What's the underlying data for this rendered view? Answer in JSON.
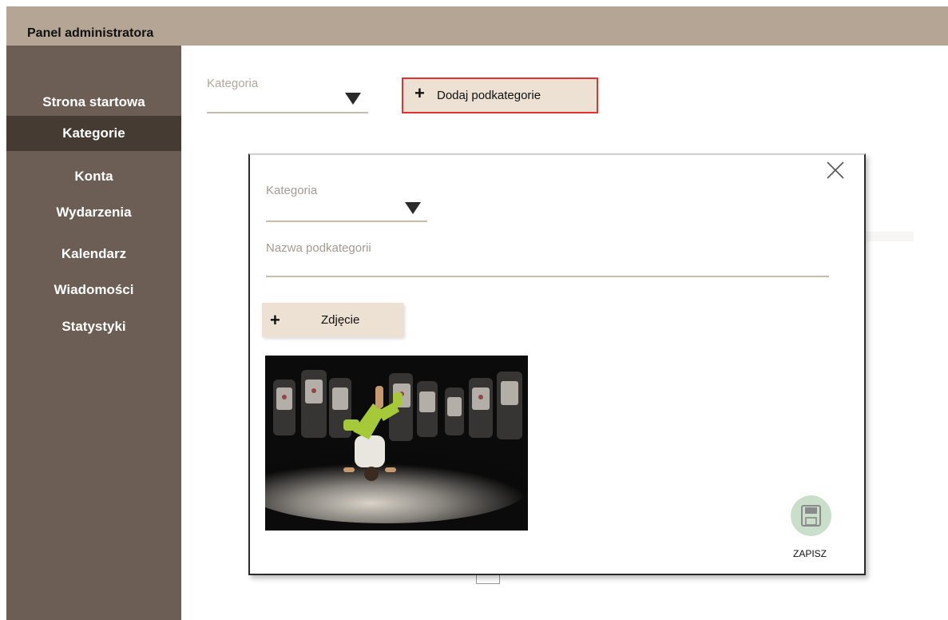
{
  "header": {
    "title": "Panel administratora"
  },
  "sidebar": {
    "items": [
      {
        "label": "Strona startowa",
        "active": false
      },
      {
        "label": "Kategorie",
        "active": true
      },
      {
        "label": "Konta",
        "active": false
      },
      {
        "label": "Wydarzenia",
        "active": false
      },
      {
        "label": "Kalendarz",
        "active": false
      },
      {
        "label": "Wiadomości",
        "active": false
      },
      {
        "label": "Statystyki",
        "active": false
      }
    ]
  },
  "main": {
    "category_label": "Kategoria",
    "add_subcategory_label": "Dodaj podkategorie",
    "add_subcategory_icon": "plus-icon"
  },
  "modal": {
    "close_icon": "close-icon",
    "category_label": "Kategoria",
    "subcategory_name_label": "Nazwa podkategorii",
    "photo_button_label": "Zdjęcie",
    "photo_button_icon": "plus-icon",
    "save_label": "ZAPISZ",
    "save_icon": "floppy-disk-icon"
  },
  "colors": {
    "topbar": "#b4a595",
    "sidebar": "#6c5e54",
    "sidebar_active": "#463b33",
    "button_bg": "#ece1d2",
    "highlight_border": "#e3312f",
    "save_bg": "#c9dfc9"
  }
}
